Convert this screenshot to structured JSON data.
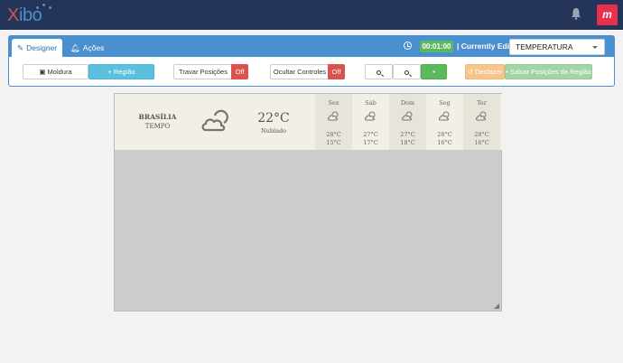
{
  "app": {
    "logo": "Xibo",
    "logo_x": "X",
    "logo_rest": "ibo",
    "avatar_text": "m"
  },
  "colors": {
    "topbar": "#25355a",
    "accent": "#4a8fd0",
    "success": "#5cb85c",
    "danger": "#d9534f",
    "info": "#5bc0de",
    "warning": "#f6c58d"
  },
  "tabs": [
    {
      "label": "Designer",
      "icon": "edit-icon"
    },
    {
      "label": "Ações",
      "icon": "bell-icon"
    }
  ],
  "header": {
    "timer": "00:01:00",
    "editing_label": "| Currently Editing",
    "layout_selected": "TEMPERATURA"
  },
  "toolbar": {
    "moldura": "Moldura",
    "regiao": "+ Região",
    "travar": "Travar Posições",
    "travar_state": "Off",
    "ocultar": "Ocultar Controles",
    "ocultar_state": "Off",
    "desfazer": "Desfazer",
    "salvar": "Salvar Posições da Região"
  },
  "weather": {
    "city": "BRASÍLIA",
    "subtitle": "TEMPO",
    "current_temp": "22°C",
    "condition": "Nublado",
    "forecast": [
      {
        "day": "Sex",
        "high": "28°C",
        "low": "15°C"
      },
      {
        "day": "Sáb",
        "high": "27°C",
        "low": "17°C"
      },
      {
        "day": "Dom",
        "high": "27°C",
        "low": "18°C"
      },
      {
        "day": "Seg",
        "high": "28°C",
        "low": "16°C"
      },
      {
        "day": "Ter",
        "high": "28°C",
        "low": "16°C"
      }
    ]
  }
}
